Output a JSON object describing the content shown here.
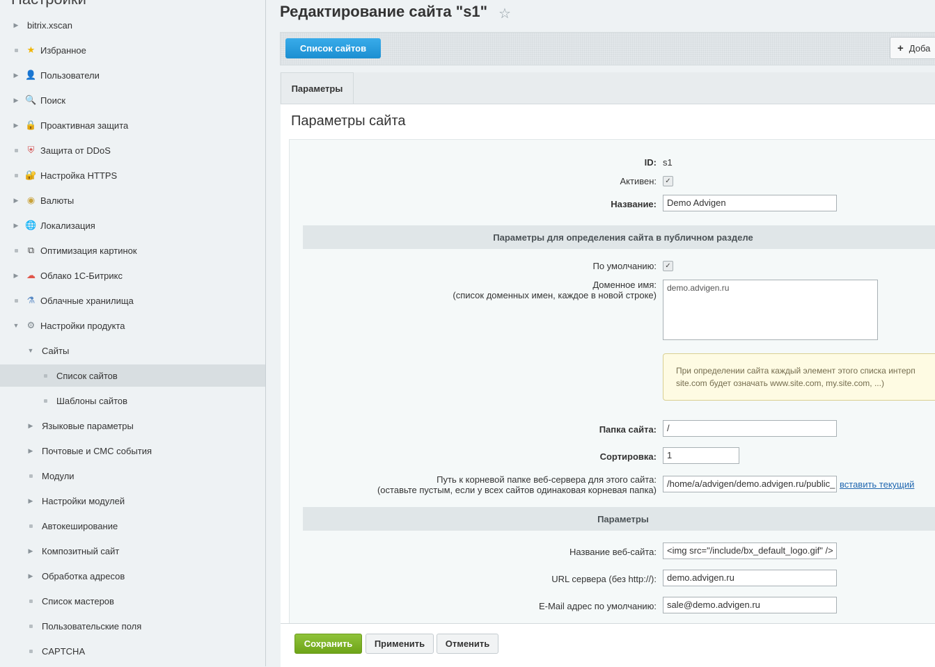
{
  "sidebar": {
    "top_title": "Настройки",
    "items": [
      {
        "label": "bitrix.xscan",
        "marker": "arrow",
        "icon": "none"
      },
      {
        "label": "Избранное",
        "marker": "dot",
        "icon": "star"
      },
      {
        "label": "Пользователи",
        "marker": "arrow",
        "icon": "user"
      },
      {
        "label": "Поиск",
        "marker": "arrow",
        "icon": "search"
      },
      {
        "label": "Проактивная защита",
        "marker": "arrow",
        "icon": "lock"
      },
      {
        "label": "Защита от DDoS",
        "marker": "dot",
        "icon": "shield"
      },
      {
        "label": "Настройка HTTPS",
        "marker": "dot",
        "icon": "https-lock"
      },
      {
        "label": "Валюты",
        "marker": "arrow",
        "icon": "coin"
      },
      {
        "label": "Локализация",
        "marker": "arrow",
        "icon": "globe"
      },
      {
        "label": "Оптимизация картинок",
        "marker": "dot",
        "icon": "image-crop"
      },
      {
        "label": "Облако 1С-Битрикс",
        "marker": "arrow",
        "icon": "cloud"
      },
      {
        "label": "Облачные хранилища",
        "marker": "dot",
        "icon": "flask"
      },
      {
        "label": "Настройки продукта",
        "marker": "arrow-down",
        "icon": "gear"
      },
      {
        "label": "Сайты",
        "marker": "arrow-down",
        "icon": "none"
      },
      {
        "label": "Список сайтов",
        "marker": "dot",
        "icon": "none"
      },
      {
        "label": "Шаблоны сайтов",
        "marker": "dot",
        "icon": "none"
      },
      {
        "label": "Языковые параметры",
        "marker": "arrow",
        "icon": "none"
      },
      {
        "label": "Почтовые и СМС события",
        "marker": "arrow",
        "icon": "none"
      },
      {
        "label": "Модули",
        "marker": "dot",
        "icon": "none"
      },
      {
        "label": "Настройки модулей",
        "marker": "arrow",
        "icon": "none"
      },
      {
        "label": "Автокеширование",
        "marker": "dot",
        "icon": "none"
      },
      {
        "label": "Композитный сайт",
        "marker": "arrow",
        "icon": "none"
      },
      {
        "label": "Обработка адресов",
        "marker": "arrow",
        "icon": "none"
      },
      {
        "label": "Список мастеров",
        "marker": "dot",
        "icon": "none"
      },
      {
        "label": "Пользовательские поля",
        "marker": "dot",
        "icon": "none"
      },
      {
        "label": "CAPTCHA",
        "marker": "dot",
        "icon": "none"
      }
    ]
  },
  "header": {
    "title": "Редактирование сайта \"s1\"",
    "star": "☆"
  },
  "toolbar": {
    "list_button": "Список сайтов",
    "add_button": "Доба"
  },
  "tabs": [
    "Параметры"
  ],
  "form": {
    "section_title": "Параметры сайта",
    "id_label": "ID:",
    "id_value": "s1",
    "active_label": "Активен:",
    "active_checked": true,
    "name_label": "Название:",
    "name_value": "Demo Advigen",
    "public_heading": "Параметры для определения сайта в публичном разделе",
    "default_label": "По умолчанию:",
    "default_checked": true,
    "domain_label": "Доменное имя:",
    "domain_hint": "(список доменных имен, каждое в новой строке)",
    "domain_value": "demo.advigen.ru",
    "note_line1": "При определении сайта каждый элемент этого списка интерп",
    "note_line2": "site.com будет означать www.site.com, my.site.com, ...)",
    "folder_label": "Папка сайта:",
    "folder_value": "/",
    "sort_label": "Сортировка:",
    "sort_value": "1",
    "docroot_label": "Путь к корневой папке веб-сервера для этого сайта:",
    "docroot_hint": "(оставьте пустым, если у всех сайтов одинаковая корневая папка)",
    "docroot_value": "/home/a/advigen/demo.advigen.ru/public_",
    "docroot_link": "вставить текущий",
    "params_heading": "Параметры",
    "sitename_label": "Название веб-сайта:",
    "sitename_value": "<img src=\"/include/bx_default_logo.gif\"  />",
    "url_label": "URL сервера (без http://):",
    "url_value": "demo.advigen.ru",
    "email_label": "E-Mail адрес по умолчанию:",
    "email_value": "sale@demo.advigen.ru"
  },
  "footer": {
    "save": "Сохранить",
    "apply": "Применить",
    "cancel": "Отменить"
  },
  "colors": {
    "accent_blue": "#2fa0df",
    "save_green": "#7db22a",
    "active_row": "#d8dee1",
    "link": "#2067b0"
  }
}
